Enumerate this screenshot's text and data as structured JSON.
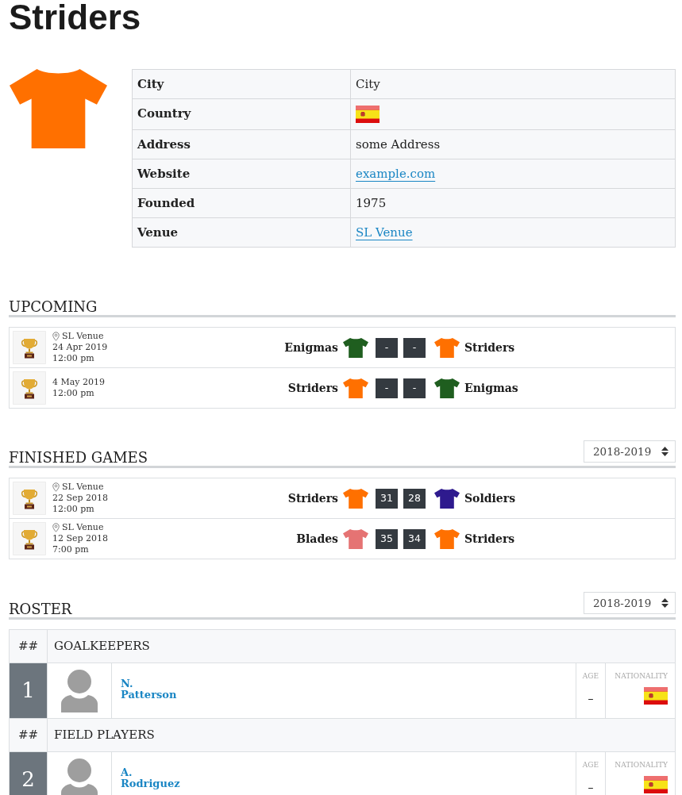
{
  "title": "Striders",
  "info": [
    {
      "label": "City",
      "kind": "text",
      "value": "City"
    },
    {
      "label": "Country",
      "kind": "flag"
    },
    {
      "label": "Address",
      "kind": "text",
      "value": "some Address"
    },
    {
      "label": "Website",
      "kind": "link",
      "value": "example.com"
    },
    {
      "label": "Founded",
      "kind": "text",
      "value": "1975"
    },
    {
      "label": "Venue",
      "kind": "link",
      "value": "SL Venue"
    }
  ],
  "upcoming": {
    "heading": "UPCOMING",
    "matches": [
      {
        "venue": "SL Venue",
        "date": "24 Apr 2019",
        "time": "12:00 pm",
        "home": {
          "name": "Enigmas",
          "color": "#1f5e1f"
        },
        "home_score": "-",
        "away_score": "-",
        "away": {
          "name": "Striders",
          "color": "#ff7000"
        }
      },
      {
        "date": "4 May 2019",
        "time": "12:00 pm",
        "home": {
          "name": "Striders",
          "color": "#ff7000"
        },
        "home_score": "-",
        "away_score": "-",
        "away": {
          "name": "Enigmas",
          "color": "#1f5e1f"
        }
      }
    ]
  },
  "finished": {
    "heading": "FINISHED GAMES",
    "season": "2018-2019",
    "matches": [
      {
        "venue": "SL Venue",
        "date": "22 Sep 2018",
        "time": "12:00 pm",
        "home": {
          "name": "Striders",
          "color": "#ff7000"
        },
        "home_score": "31",
        "away_score": "28",
        "away": {
          "name": "Soldiers",
          "color": "#2e1a8e"
        }
      },
      {
        "venue": "SL Venue",
        "date": "12 Sep 2018",
        "time": "7:00 pm",
        "home": {
          "name": "Blades",
          "color": "#e57373"
        },
        "home_score": "35",
        "away_score": "34",
        "away": {
          "name": "Striders",
          "color": "#ff7000"
        }
      }
    ]
  },
  "roster": {
    "heading": "ROSTER",
    "season": "2018-2019",
    "groups": [
      {
        "number_header": "##",
        "title": "GOALKEEPERS",
        "players": [
          {
            "number": "1",
            "first_name": "N.",
            "last_name": "Patterson",
            "age_label": "AGE",
            "age": "–",
            "nationality_label": "NATIONALITY"
          }
        ]
      },
      {
        "number_header": "##",
        "title": "FIELD PLAYERS",
        "players": [
          {
            "number": "2",
            "first_name": "A.",
            "last_name": "Rodriguez",
            "age_label": "AGE",
            "age": "–",
            "nationality_label": "NATIONALITY"
          }
        ]
      }
    ]
  }
}
